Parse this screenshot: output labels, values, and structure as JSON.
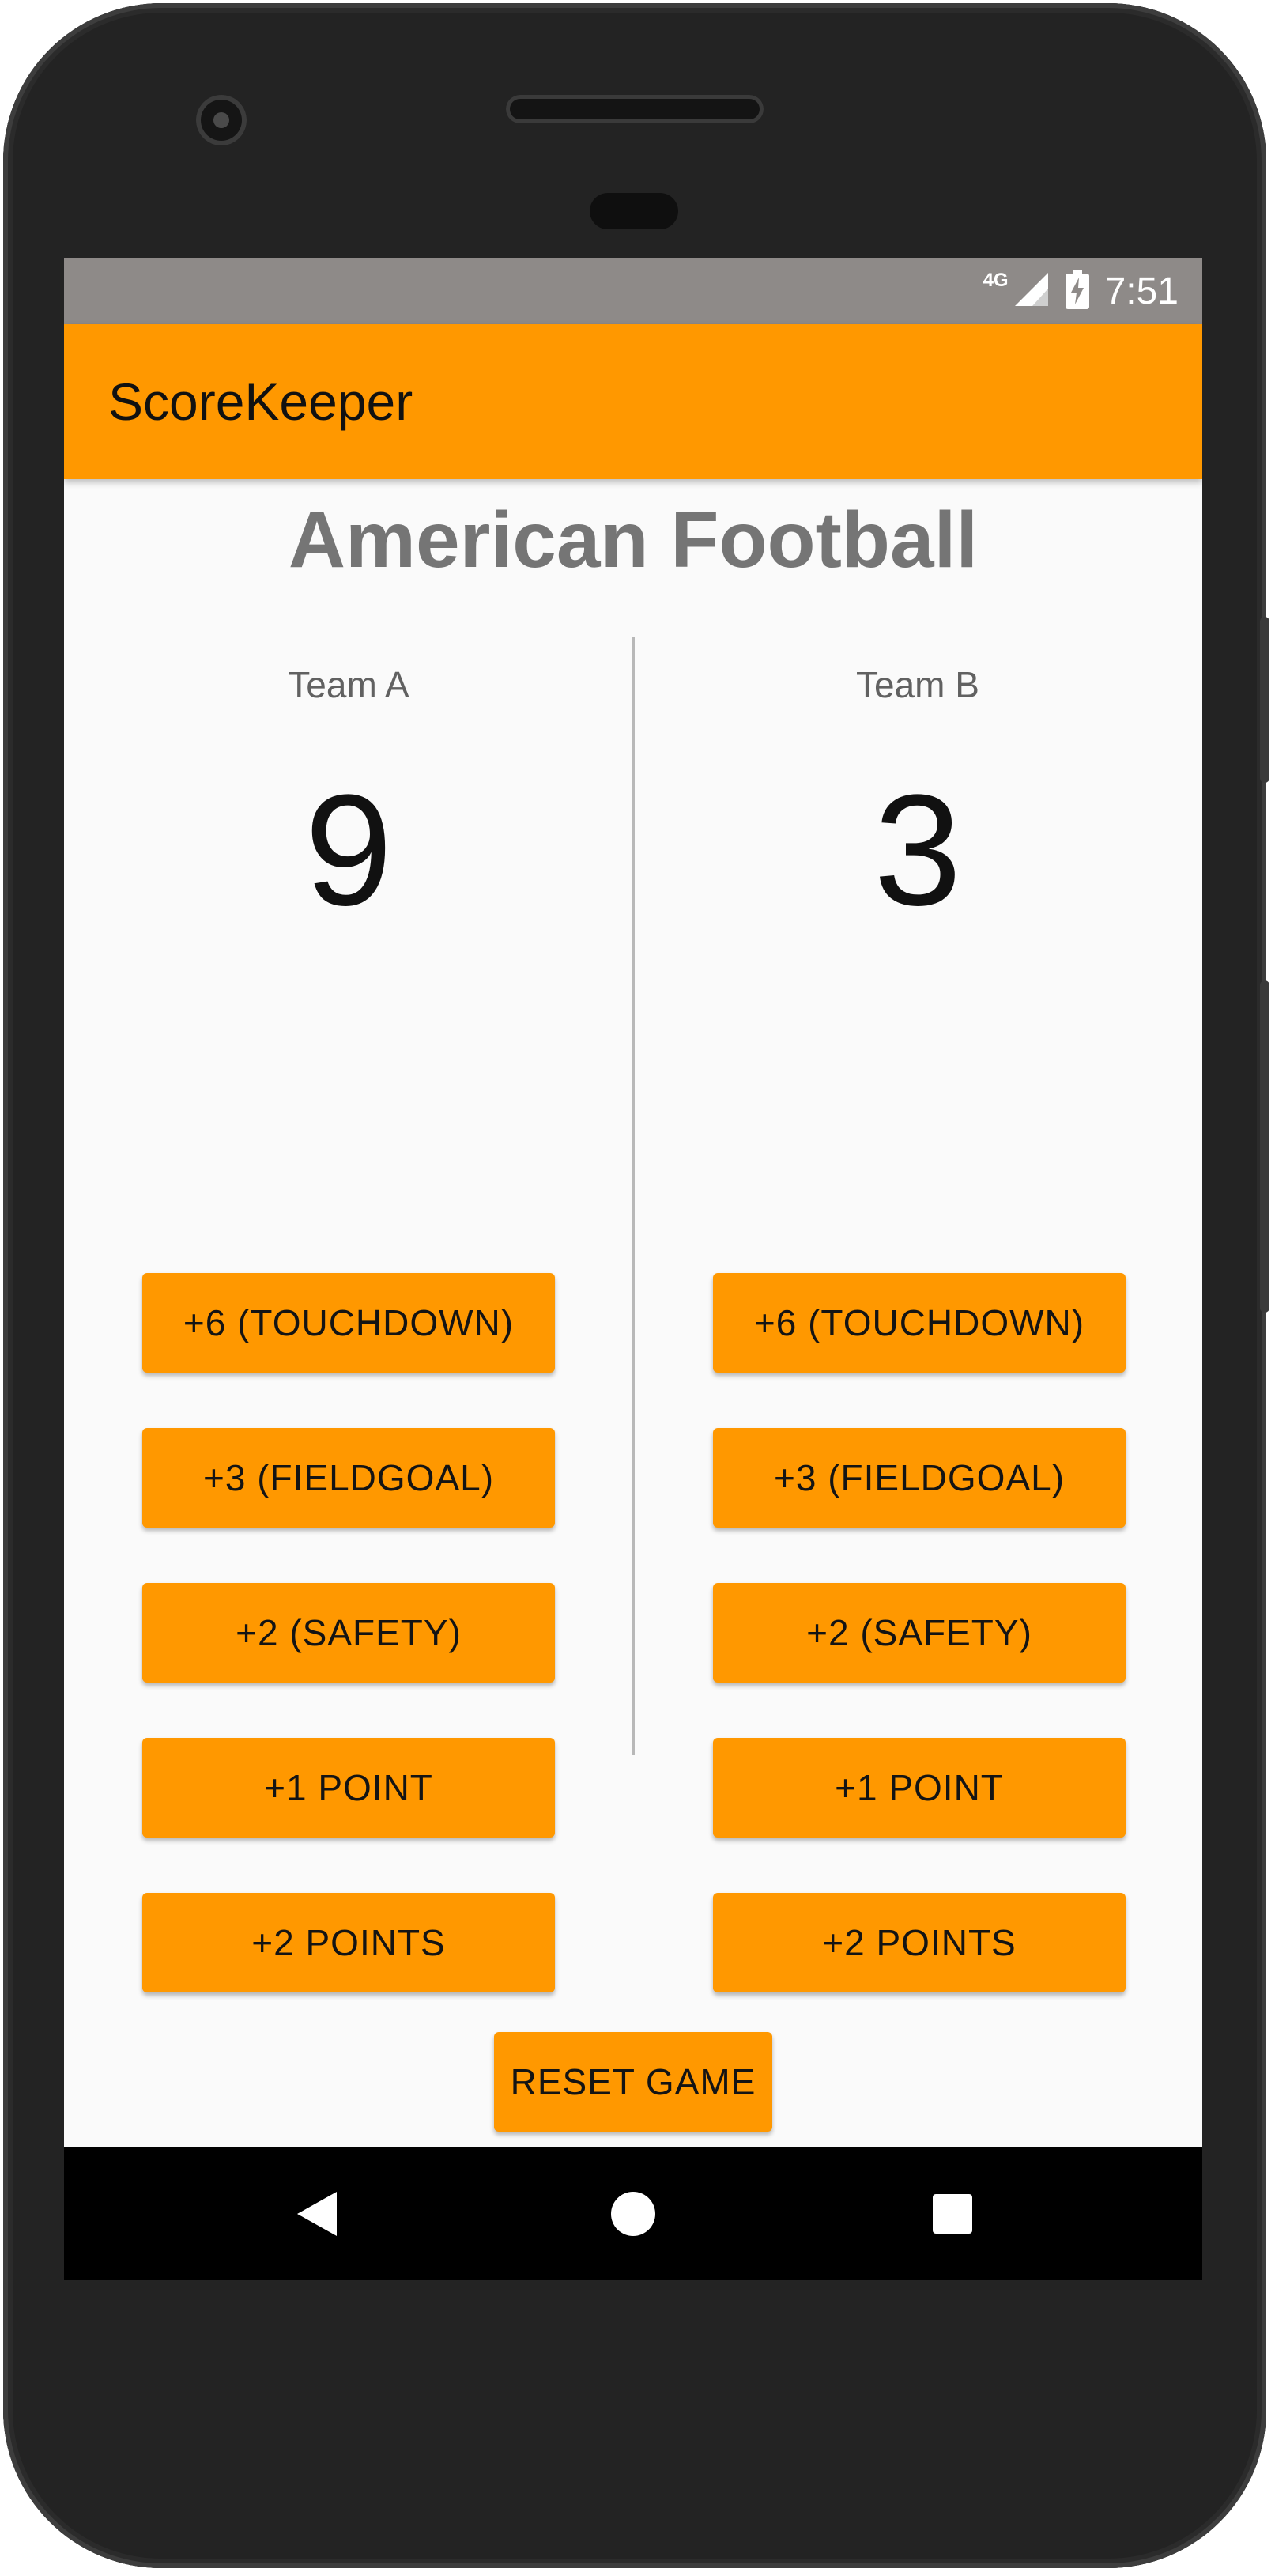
{
  "status_bar": {
    "network_label": "4G",
    "time": "7:51",
    "icons": [
      "signal-icon",
      "battery-charging-icon"
    ]
  },
  "app_bar": {
    "title": "ScoreKeeper"
  },
  "main": {
    "heading": "American Football",
    "teams": [
      {
        "name": "Team A",
        "score": "9",
        "buttons": [
          "+6 (TOUCHDOWN)",
          "+3 (FIELDGOAL)",
          "+2 (SAFETY)",
          "+1 POINT",
          "+2 POINTS"
        ]
      },
      {
        "name": "Team B",
        "score": "3",
        "buttons": [
          "+6 (TOUCHDOWN)",
          "+3 (FIELDGOAL)",
          "+2 (SAFETY)",
          "+1 POINT",
          "+2 POINTS"
        ]
      }
    ],
    "reset_label": "RESET GAME"
  },
  "nav_bar": {
    "icons": [
      "back-icon",
      "home-icon",
      "recents-icon"
    ]
  },
  "colors": {
    "accent": "#ff9800",
    "status_bar": "#8e8a88",
    "background": "#fafafa",
    "heading_text": "#757575",
    "phone_body": "#232323"
  }
}
